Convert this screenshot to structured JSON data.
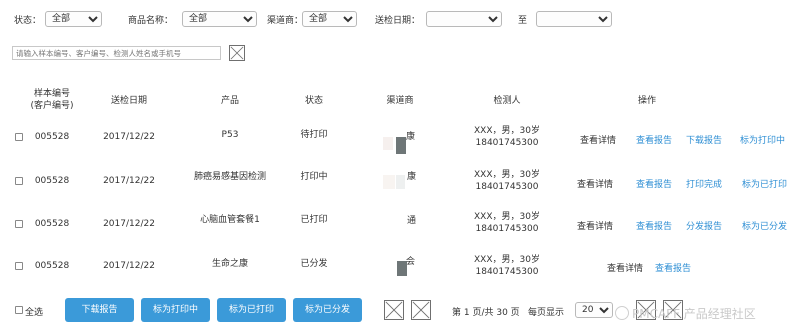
{
  "filters": {
    "status_label": "状态：",
    "status_value": "全部",
    "product_label": "商品名称：",
    "product_value": "全部",
    "channel_label": "渠道商：",
    "channel_value": "全部",
    "date_label": "送检日期：",
    "date_from": "",
    "date_sep": "至",
    "date_to": ""
  },
  "search": {
    "placeholder": "请输入样本编号、客户编号、检测人姓名或手机号"
  },
  "table": {
    "headers": {
      "sample_line1": "样本编号",
      "sample_line2": "(客户编号)",
      "date": "送检日期",
      "product": "产品",
      "status": "状态",
      "channel": "渠道商",
      "person": "检测人",
      "ops": "操作"
    },
    "rows": [
      {
        "sample": "005528",
        "date": "2017/12/22",
        "product": "P53",
        "status": "待打印",
        "channel": "康",
        "person": "XXX，男，30岁",
        "phone": "18401745300",
        "actions": [
          "查看详情",
          "查看报告",
          "下载报告",
          "标为打印中"
        ]
      },
      {
        "sample": "005528",
        "date": "2017/12/22",
        "product": "肺癌易感基因检测",
        "status": "打印中",
        "channel": "康",
        "person": "XXX，男，30岁",
        "phone": "18401745300",
        "actions": [
          "查看详情",
          "查看报告",
          "打印完成",
          "标为已打印"
        ]
      },
      {
        "sample": "005528",
        "date": "2017/12/22",
        "product": "心脑血管套餐1",
        "status": "已打印",
        "channel": "通",
        "person": "XXX，男，30岁",
        "phone": "18401745300",
        "actions": [
          "查看详情",
          "查看报告",
          "分发报告",
          "标为已分发"
        ]
      },
      {
        "sample": "005528",
        "date": "2017/12/22",
        "product": "生命之康",
        "status": "已分发",
        "channel": "会",
        "person": "XXX，男，30岁",
        "phone": "18401745300",
        "actions": [
          "查看详情",
          "查看报告"
        ]
      }
    ]
  },
  "footer": {
    "select_all": "全选",
    "buttons": [
      "下载报告",
      "标为打印中",
      "标为已打印",
      "标为已分发"
    ],
    "page_info": "第 1 页/共 30 页",
    "per_page_label": "每页显示",
    "per_page_value": "20"
  },
  "watermark": "PMCAFF 产品经理社区",
  "colors": {
    "link": "#2f8fd4",
    "button": "#3b9ad9",
    "swatch_gray": "#6e7677"
  }
}
